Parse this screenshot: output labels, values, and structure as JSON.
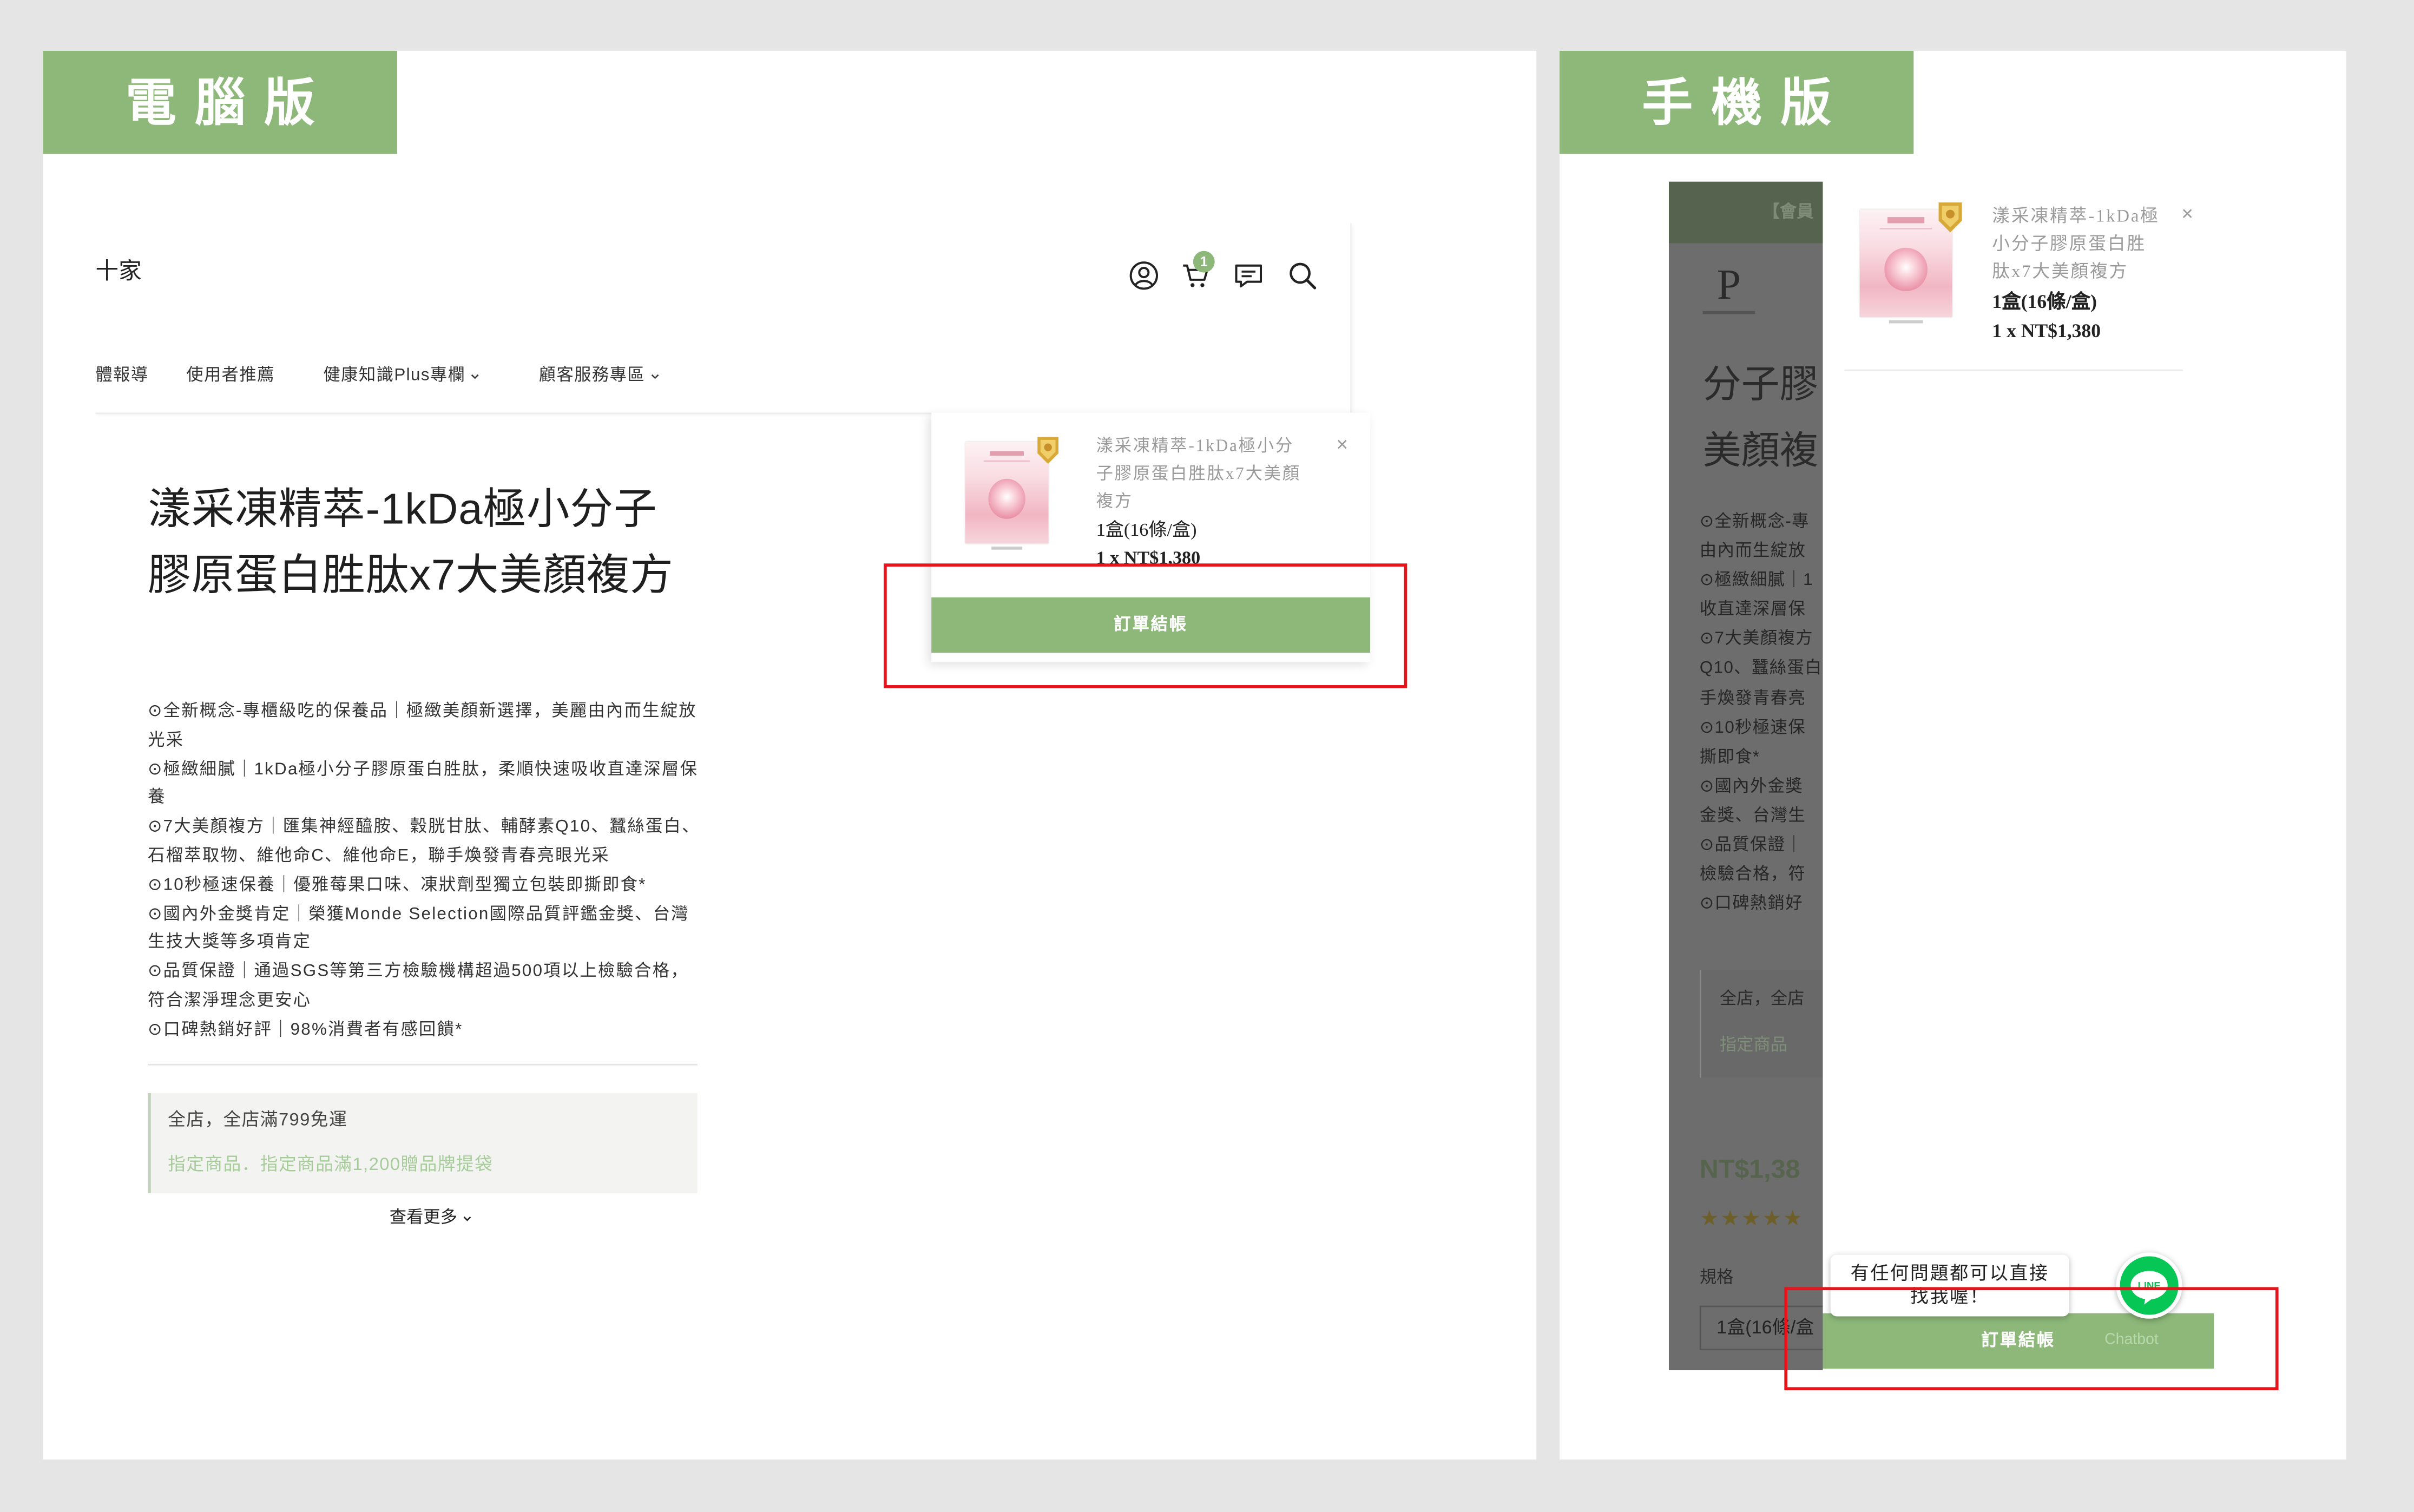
{
  "labels": {
    "desktop": "電腦版",
    "mobile": "手機版"
  },
  "colors": {
    "accent_green": "#8db87a",
    "highlight_red": "#e8141b",
    "line_green": "#06c755",
    "promo_green_text": "#a6cc99"
  },
  "desktop": {
    "header": {
      "brand_fragment": "十家",
      "icons": [
        "user-icon",
        "cart-icon",
        "chat-icon",
        "search-icon"
      ],
      "cart_count": "1",
      "nav": [
        {
          "label": "體報導",
          "has_dropdown": false
        },
        {
          "label": "使用者推薦",
          "has_dropdown": false
        },
        {
          "label": "健康知識Plus專欄",
          "has_dropdown": true
        },
        {
          "label": "顧客服務專區",
          "has_dropdown": true
        }
      ]
    },
    "product": {
      "title": "漾采凍精萃-1kDa極小分子膠原蛋白胜肽x7大美顏複方",
      "features": [
        "⊙全新概念-專櫃級吃的保養品｜極緻美顏新選擇，美麗由內而生綻放光采",
        "⊙極緻細膩｜1kDa極小分子膠原蛋白胜肽，柔順快速吸收直達深層保養",
        "⊙7大美顏複方｜匯集神經醯胺、穀胱甘肽、輔酵素Q10、蠶絲蛋白、石榴萃取物、維他命C、維他命E，聯手煥發青春亮眼光采",
        "⊙10秒極速保養｜優雅莓果口味、凍狀劑型獨立包裝即撕即食*",
        "⊙國內外金獎肯定｜榮獲Monde Selection國際品質評鑑金獎、台灣生技大獎等多項肯定",
        "⊙品質保證｜通過SGS等第三方檢驗機構超過500項以上檢驗合格，符合潔淨理念更安心",
        "⊙口碑熱銷好評｜98%消費者有感回饋*"
      ],
      "promotions": {
        "free_shipping": "全店，全店滿799免運",
        "gift": "指定商品．指定商品滿1,200贈品牌提袋"
      },
      "see_more": "查看更多"
    },
    "cart_dropdown": {
      "item_name": "漾采凍精萃-1kDa極小分子膠原蛋白胜肽x7大美顏複方",
      "variant": "1盒(16條/盒)",
      "quantity_price": "1 x NT$1,380",
      "close": "×",
      "checkout_label": "訂單結帳"
    }
  },
  "mobile": {
    "background_page": {
      "top_bar_fragment": "【會員",
      "logo_letter": "P",
      "title_fragments": [
        "分子膠",
        "美顏複"
      ],
      "feature_fragments": [
        "⊙全新概念-專",
        "由內而生綻放",
        "⊙極緻細膩｜1",
        "收直達深層保",
        "⊙7大美顏複方",
        "Q10、蠶絲蛋白",
        "手煥發青春亮",
        "⊙10秒極速保",
        "撕即食*",
        "⊙國內外金獎",
        "金獎、台灣生",
        "⊙品質保證｜",
        "檢驗合格，符",
        "⊙口碑熱銷好"
      ],
      "promotion_fragments": [
        "全店，全店",
        "指定商品"
      ],
      "price_fragment": "NT$1,38",
      "rating_stars": "★★★★★",
      "spec_label": "規格",
      "spec_value_fragment": "1盒(16條/盒"
    },
    "cart_drawer": {
      "item_name": "漾采凍精萃-1kDa極小分子膠原蛋白胜肽x7大美顏複方",
      "variant": "1盒(16條/盒)",
      "quantity_price": "1 x NT$1,380",
      "close": "×",
      "checkout_label": "訂單結帳",
      "chatbot_label": "Chatbot"
    },
    "chat_bubble": "有任何問題都可以直接找我喔！",
    "line_logo_text": "LINE"
  }
}
